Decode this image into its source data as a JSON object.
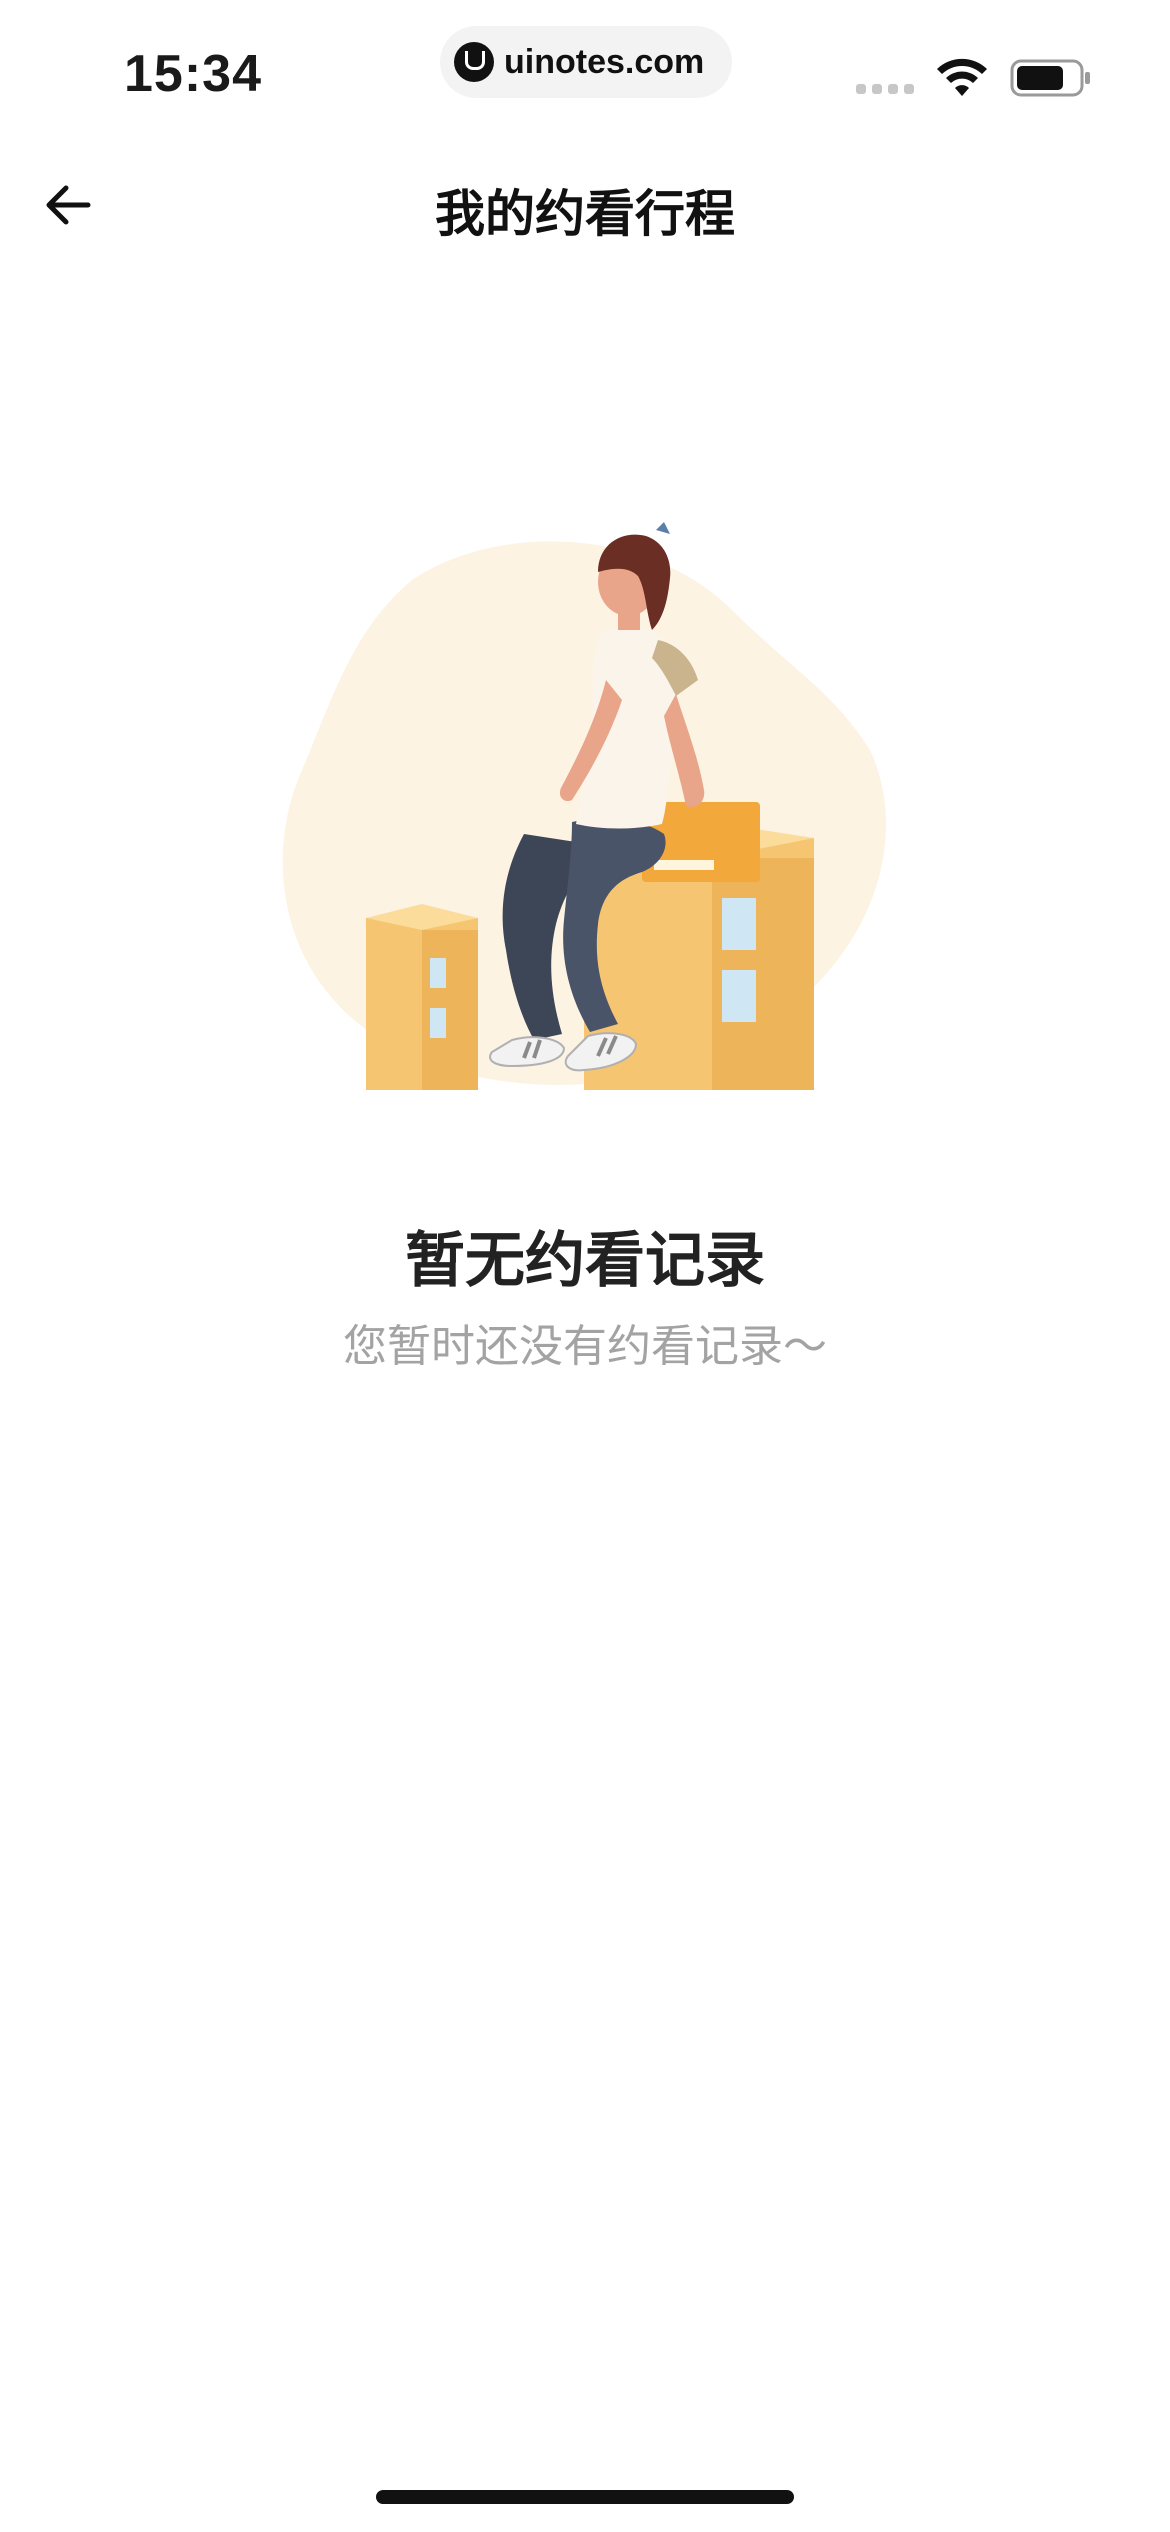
{
  "status_bar": {
    "time": "15:34",
    "url": "uinotes.com",
    "icons": [
      "signal-icon",
      "wifi-icon",
      "battery-icon"
    ]
  },
  "nav": {
    "back_icon": "arrow-left-icon",
    "title": "我的约看行程"
  },
  "empty_state": {
    "illustration": "person-sitting-on-buildings-illustration",
    "title": "暂无约看记录",
    "subtitle": "您暂时还没有约看记录～"
  },
  "colors": {
    "background": "#ffffff",
    "title": "#222222",
    "subtitle": "#a3a3a3",
    "accent_orange": "#f2a83b"
  }
}
